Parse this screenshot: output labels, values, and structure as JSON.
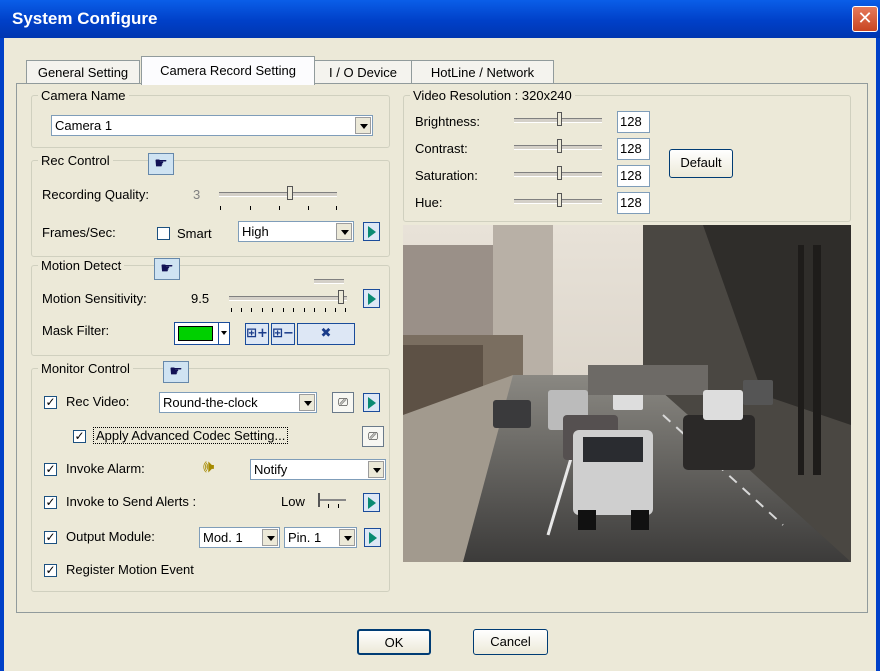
{
  "window": {
    "title": "System Configure"
  },
  "tabs": [
    {
      "label": "General Setting"
    },
    {
      "label": "Camera Record Setting"
    },
    {
      "label": "I / O Device"
    },
    {
      "label": "HotLine / Network"
    }
  ],
  "camera_name": {
    "legend": "Camera Name",
    "value": "Camera 1"
  },
  "rec_control": {
    "legend": "Rec Control",
    "quality_label": "Recording Quality:",
    "quality_value": "3",
    "quality_level": 0.6,
    "fps_label": "Frames/Sec:",
    "smart_label": "Smart",
    "smart_checked": false,
    "fps_value": "High"
  },
  "motion_detect": {
    "legend": "Motion Detect",
    "sensitivity_label": "Motion Sensitivity:",
    "sensitivity_value": "9.5",
    "sensitivity_level": 0.95,
    "mask_label": "Mask Filter:",
    "mask_color": "#00d000"
  },
  "monitor_control": {
    "legend": "Monitor Control",
    "rec_video_label": "Rec Video:",
    "rec_video_value": "Round-the-clock",
    "codec_label": "Apply Advanced Codec Setting...",
    "alarm_label": "Invoke Alarm:",
    "alarm_value": "Notify",
    "alerts_label": "Invoke to Send Alerts :",
    "alerts_level": "Low",
    "output_label": "Output Module:",
    "output_module": "Mod. 1",
    "output_pin": "Pin. 1",
    "register_label": "Register Motion Event"
  },
  "video": {
    "legend": "Video Resolution : 320x240",
    "brightness_label": "Brightness:",
    "brightness_value": "128",
    "contrast_label": "Contrast:",
    "contrast_value": "128",
    "saturation_label": "Saturation:",
    "saturation_value": "128",
    "hue_label": "Hue:",
    "hue_value": "128",
    "default_label": "Default"
  },
  "buttons": {
    "ok": "OK",
    "cancel": "Cancel"
  },
  "icons": [
    "close-icon",
    "hand-pointer-icon",
    "play-arrow-icon",
    "dropdown-arrow-icon",
    "speaker-icon",
    "codec-settings-icon",
    "mask-add-icon",
    "mask-remove-icon",
    "mask-clear-icon",
    "level-slider-icon"
  ]
}
